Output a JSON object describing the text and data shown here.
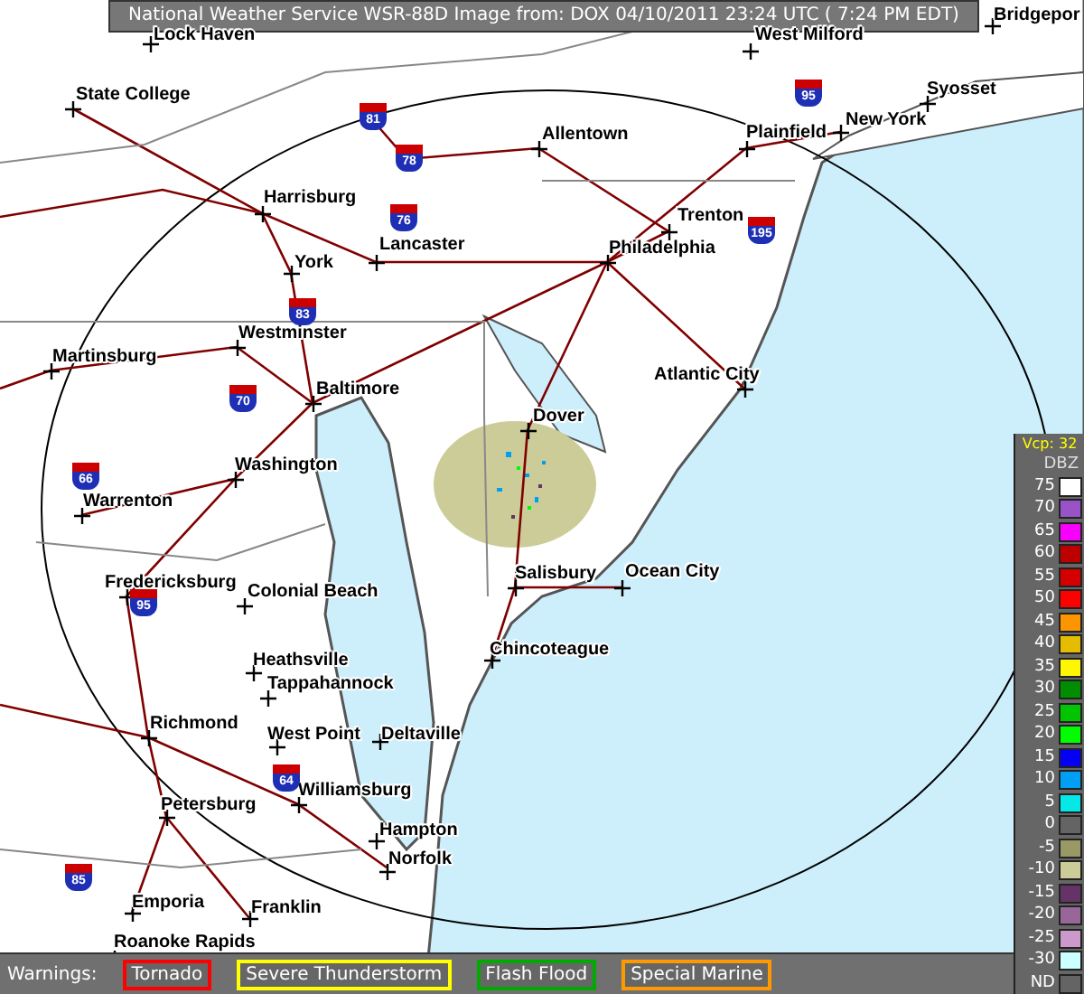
{
  "title": "National Weather Service WSR-88D Image from: DOX 04/10/2011 23:24 UTC ( 7:24 PM EDT)",
  "map": {
    "cities": [
      {
        "name": "Lock Haven"
      },
      {
        "name": "West Milford"
      },
      {
        "name": "Bridgepor"
      },
      {
        "name": "State College"
      },
      {
        "name": "Syosset"
      },
      {
        "name": "Allentown"
      },
      {
        "name": "Plainfield"
      },
      {
        "name": "New York"
      },
      {
        "name": "Harrisburg"
      },
      {
        "name": "Lancaster"
      },
      {
        "name": "Trenton"
      },
      {
        "name": "Philadelphia"
      },
      {
        "name": "York"
      },
      {
        "name": "Westminster"
      },
      {
        "name": "Martinsburg"
      },
      {
        "name": "Atlantic City"
      },
      {
        "name": "Baltimore"
      },
      {
        "name": "Dover"
      },
      {
        "name": "Washington"
      },
      {
        "name": "Warrenton"
      },
      {
        "name": "Salisbury"
      },
      {
        "name": "Ocean City"
      },
      {
        "name": "Fredericksburg"
      },
      {
        "name": "Colonial Beach"
      },
      {
        "name": "Chincoteague"
      },
      {
        "name": "Heathsville"
      },
      {
        "name": "Tappahannock"
      },
      {
        "name": "Richmond"
      },
      {
        "name": "West Point"
      },
      {
        "name": "Deltaville"
      },
      {
        "name": "Williamsburg"
      },
      {
        "name": "Petersburg"
      },
      {
        "name": "Hampton"
      },
      {
        "name": "Norfolk"
      },
      {
        "name": "Emporia"
      },
      {
        "name": "Franklin"
      },
      {
        "name": "Roanoke Rapids"
      }
    ],
    "interstates": [
      "81",
      "78",
      "76",
      "95",
      "195",
      "83",
      "70",
      "66",
      "95",
      "64",
      "85"
    ]
  },
  "legend": {
    "vcp": "Vcp: 32",
    "unit": "DBZ",
    "levels": [
      {
        "label": "75",
        "color": "#ffffff"
      },
      {
        "label": "70",
        "color": "#9854c6"
      },
      {
        "label": "65",
        "color": "#f800fd"
      },
      {
        "label": "60",
        "color": "#bc0000"
      },
      {
        "label": "55",
        "color": "#d40000"
      },
      {
        "label": "50",
        "color": "#fd0000"
      },
      {
        "label": "45",
        "color": "#fd9500"
      },
      {
        "label": "40",
        "color": "#e5bc00"
      },
      {
        "label": "35",
        "color": "#fdf802"
      },
      {
        "label": "30",
        "color": "#008e00"
      },
      {
        "label": "25",
        "color": "#01c501"
      },
      {
        "label": "20",
        "color": "#02fd02"
      },
      {
        "label": "15",
        "color": "#0300f4"
      },
      {
        "label": "10",
        "color": "#019ff4"
      },
      {
        "label": "5",
        "color": "#04e9e7"
      },
      {
        "label": "0",
        "color": "#646464"
      },
      {
        "label": "-5",
        "color": "#999966"
      },
      {
        "label": "-10",
        "color": "#cccc99"
      },
      {
        "label": "-15",
        "color": "#663366"
      },
      {
        "label": "-20",
        "color": "#996699"
      },
      {
        "label": "-25",
        "color": "#cc99cc"
      },
      {
        "label": "-30",
        "color": "#ccffff"
      },
      {
        "label": "ND",
        "color": "#646464"
      }
    ]
  },
  "warnings": {
    "label": "Warnings:",
    "items": [
      {
        "label": "Tornado",
        "color": "#ff0000"
      },
      {
        "label": "Severe Thunderstorm",
        "color": "#ffff00"
      },
      {
        "label": "Flash Flood",
        "color": "#00aa00"
      },
      {
        "label": "Special Marine",
        "color": "#ff9900"
      }
    ]
  }
}
